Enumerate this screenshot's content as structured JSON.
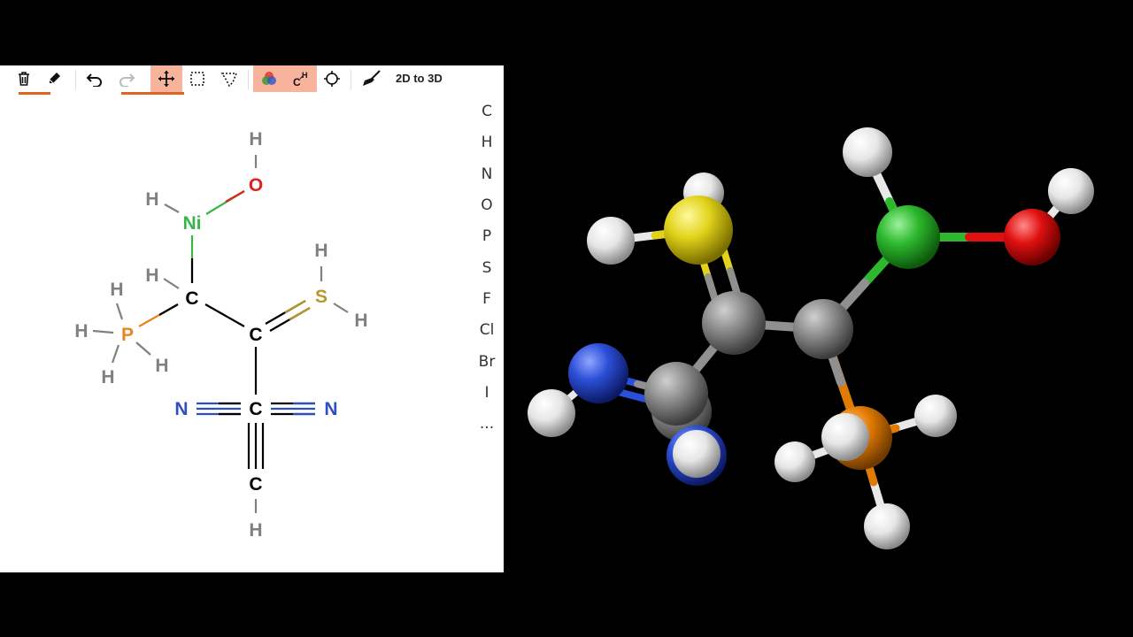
{
  "toolbar": {
    "buttons": [
      {
        "name": "clear-button",
        "icon": "trash-icon"
      },
      {
        "name": "erase-button",
        "icon": "eraser-icon"
      },
      {
        "name": "undo-button",
        "icon": "undo-icon"
      },
      {
        "name": "redo-button",
        "icon": "redo-icon"
      },
      {
        "name": "move-button",
        "icon": "move-arrows-icon",
        "active": true
      },
      {
        "name": "rect-select-button",
        "icon": "rect-select-icon"
      },
      {
        "name": "lasso-select-button",
        "icon": "lasso-icon"
      },
      {
        "name": "color-atoms-button",
        "icon": "color-circles-icon",
        "active": true
      },
      {
        "name": "show-hydrogens-button",
        "icon": "ch-icon",
        "active": true
      },
      {
        "name": "center-button",
        "icon": "crosshair-icon"
      },
      {
        "name": "clean-button",
        "icon": "broom-icon"
      }
    ],
    "convert_label": "2D to 3D"
  },
  "palette": [
    "C",
    "H",
    "N",
    "O",
    "P",
    "S",
    "F",
    "Cl",
    "Br",
    "I",
    "..."
  ],
  "sketch": {
    "atoms": [
      {
        "id": "h_oh",
        "label": "H",
        "color": "#808080"
      },
      {
        "id": "o",
        "label": "O",
        "color": "#e0211d"
      },
      {
        "id": "h_ni",
        "label": "H",
        "color": "#808080"
      },
      {
        "id": "ni",
        "label": "Ni",
        "color": "#3ab34a"
      },
      {
        "id": "h_s1",
        "label": "H",
        "color": "#808080"
      },
      {
        "id": "s",
        "label": "S",
        "color": "#b8972b"
      },
      {
        "id": "h_s2",
        "label": "H",
        "color": "#808080"
      },
      {
        "id": "h_c1",
        "label": "H",
        "color": "#808080"
      },
      {
        "id": "c1",
        "label": "C",
        "color": "#000000"
      },
      {
        "id": "h_p1",
        "label": "H",
        "color": "#808080"
      },
      {
        "id": "p",
        "label": "P",
        "color": "#e8851f"
      },
      {
        "id": "h_p2",
        "label": "H",
        "color": "#808080"
      },
      {
        "id": "h_p3",
        "label": "H",
        "color": "#808080"
      },
      {
        "id": "h_p4",
        "label": "H",
        "color": "#808080"
      },
      {
        "id": "c2",
        "label": "C",
        "color": "#000000"
      },
      {
        "id": "n1",
        "label": "N",
        "color": "#2e4fc2"
      },
      {
        "id": "c3",
        "label": "C",
        "color": "#000000"
      },
      {
        "id": "n2",
        "label": "N",
        "color": "#2e4fc2"
      },
      {
        "id": "c4",
        "label": "C",
        "color": "#000000"
      },
      {
        "id": "h_c4",
        "label": "H",
        "color": "#808080"
      }
    ]
  },
  "viewer": {
    "colors": {
      "carbon": "#8a8a8a",
      "hydrogen": "#e8e8e8",
      "nitrogen": "#2c4fd8",
      "oxygen": "#e01010",
      "sulfur": "#e2d31a",
      "nickel": "#2db82d",
      "phosphorus": "#e07a00"
    }
  }
}
